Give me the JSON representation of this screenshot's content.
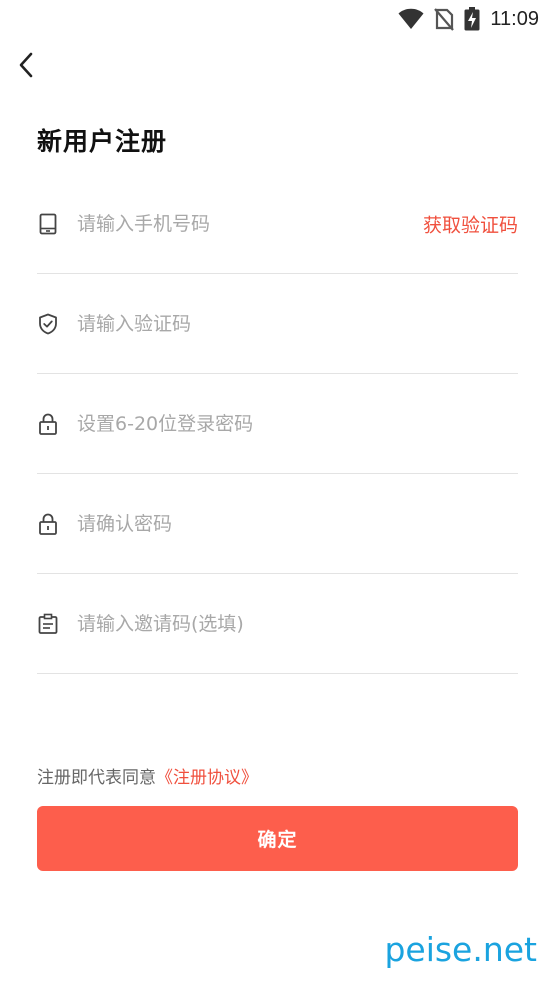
{
  "status_bar": {
    "time": "11:09"
  },
  "header": {
    "title": "新用户注册"
  },
  "form": {
    "phone_placeholder": "请输入手机号码",
    "get_code_label": "获取验证码",
    "code_placeholder": "请输入验证码",
    "password_placeholder": "设置6-20位登录密码",
    "confirm_password_placeholder": "请确认密码",
    "invite_placeholder": "请输入邀请码(选填)"
  },
  "agreement": {
    "prefix": "注册即代表同意",
    "link": "《注册协议》"
  },
  "confirm_label": "确定",
  "watermark": "peise.net",
  "colors": {
    "accent": "#f0503e",
    "button": "#fd5e4c",
    "watermark": "#1aa3df"
  }
}
